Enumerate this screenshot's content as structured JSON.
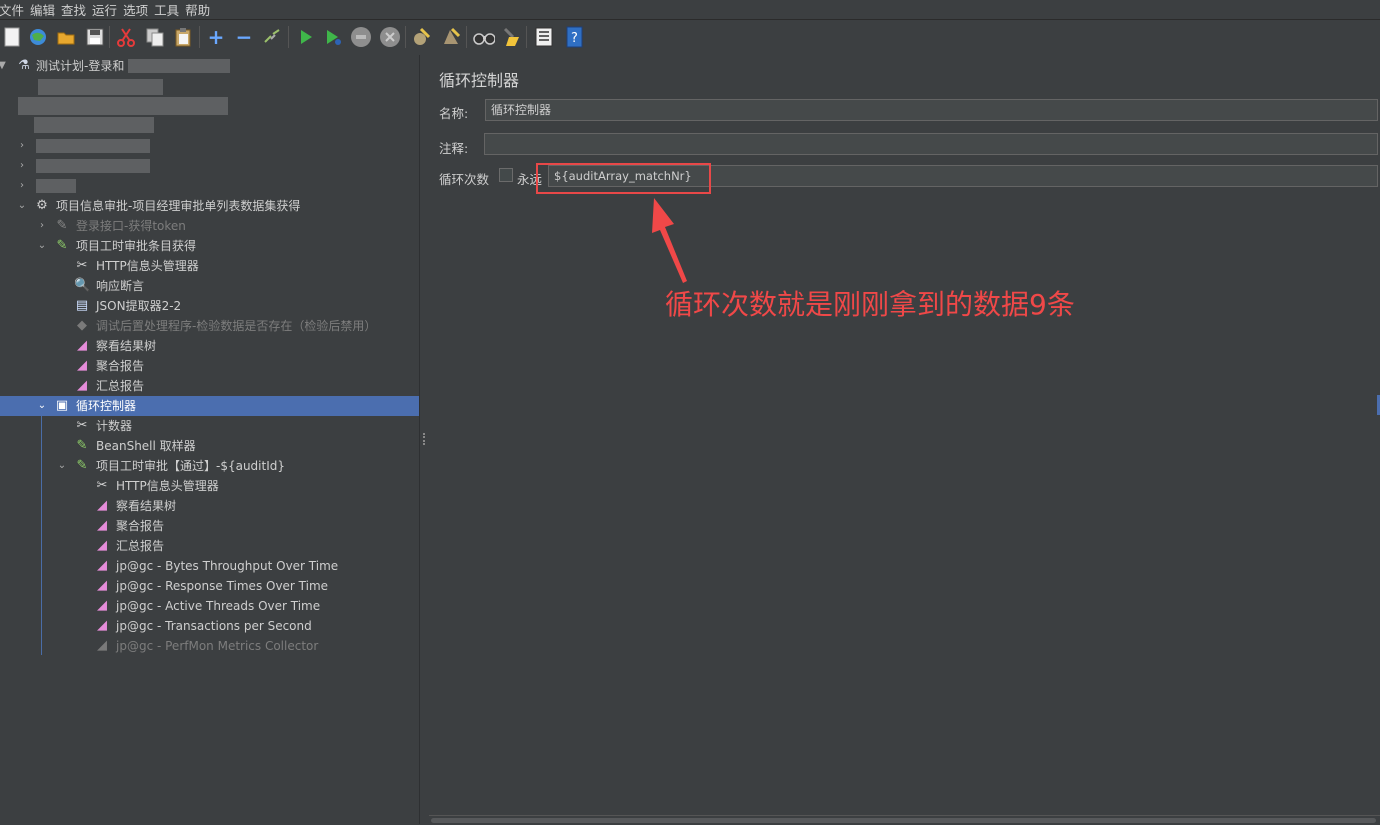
{
  "menu": [
    "文件",
    "编辑",
    "查找",
    "运行",
    "选项",
    "工具",
    "帮助"
  ],
  "toolbar_icons": [
    "new-icon",
    "templates-icon",
    "open-icon",
    "save-icon",
    "cut-icon",
    "copy-icon",
    "paste-icon",
    "expand-icon",
    "collapse-icon",
    "toggle-icon",
    "start-icon",
    "start-no-pauses-icon",
    "stop-icon",
    "shutdown-icon",
    "clear-icon",
    "clear-all-icon",
    "search-icon",
    "reset-search-icon",
    "function-helper-icon",
    "help-icon"
  ],
  "tree": {
    "root": "测试计划-登录和",
    "group": "项目信息审批-项目经理审批单列表数据集获得",
    "login": "登录接口-获得token",
    "sampler1": "项目工时审批条目获得",
    "header1": "HTTP信息头管理器",
    "assert": "响应断言",
    "json": "JSON提取器2-2",
    "post": "调试后置处理程序-检验数据是否存在（检验后禁用）",
    "view1": "察看结果树",
    "agg1": "聚合报告",
    "sum1": "汇总报告",
    "loop": "循环控制器",
    "counter": "计数器",
    "beanshell": "BeanShell 取样器",
    "sampler2": "项目工时审批【通过】-${auditId}",
    "header2": "HTTP信息头管理器",
    "view2": "察看结果树",
    "agg2": "聚合报告",
    "sum2": "汇总报告",
    "g1": "jp@gc - Bytes Throughput Over Time",
    "g2": "jp@gc - Response Times Over Time",
    "g3": "jp@gc - Active Threads Over Time",
    "g4": "jp@gc - Transactions per Second",
    "g5": "jp@gc - PerfMon Metrics Collector"
  },
  "panel": {
    "title": "循环控制器",
    "name_label": "名称:",
    "name_value": "循环控制器",
    "comment_label": "注释:",
    "comment_value": "",
    "loop_label": "循环次数",
    "forever_label": "永远",
    "loop_value": "${auditArray_matchNr}"
  },
  "annotation": "循环次数就是刚刚拿到的数据9条",
  "colors": {
    "accent": "#4b6eaf",
    "annotation": "#f04848",
    "bg": "#3c3f41"
  }
}
